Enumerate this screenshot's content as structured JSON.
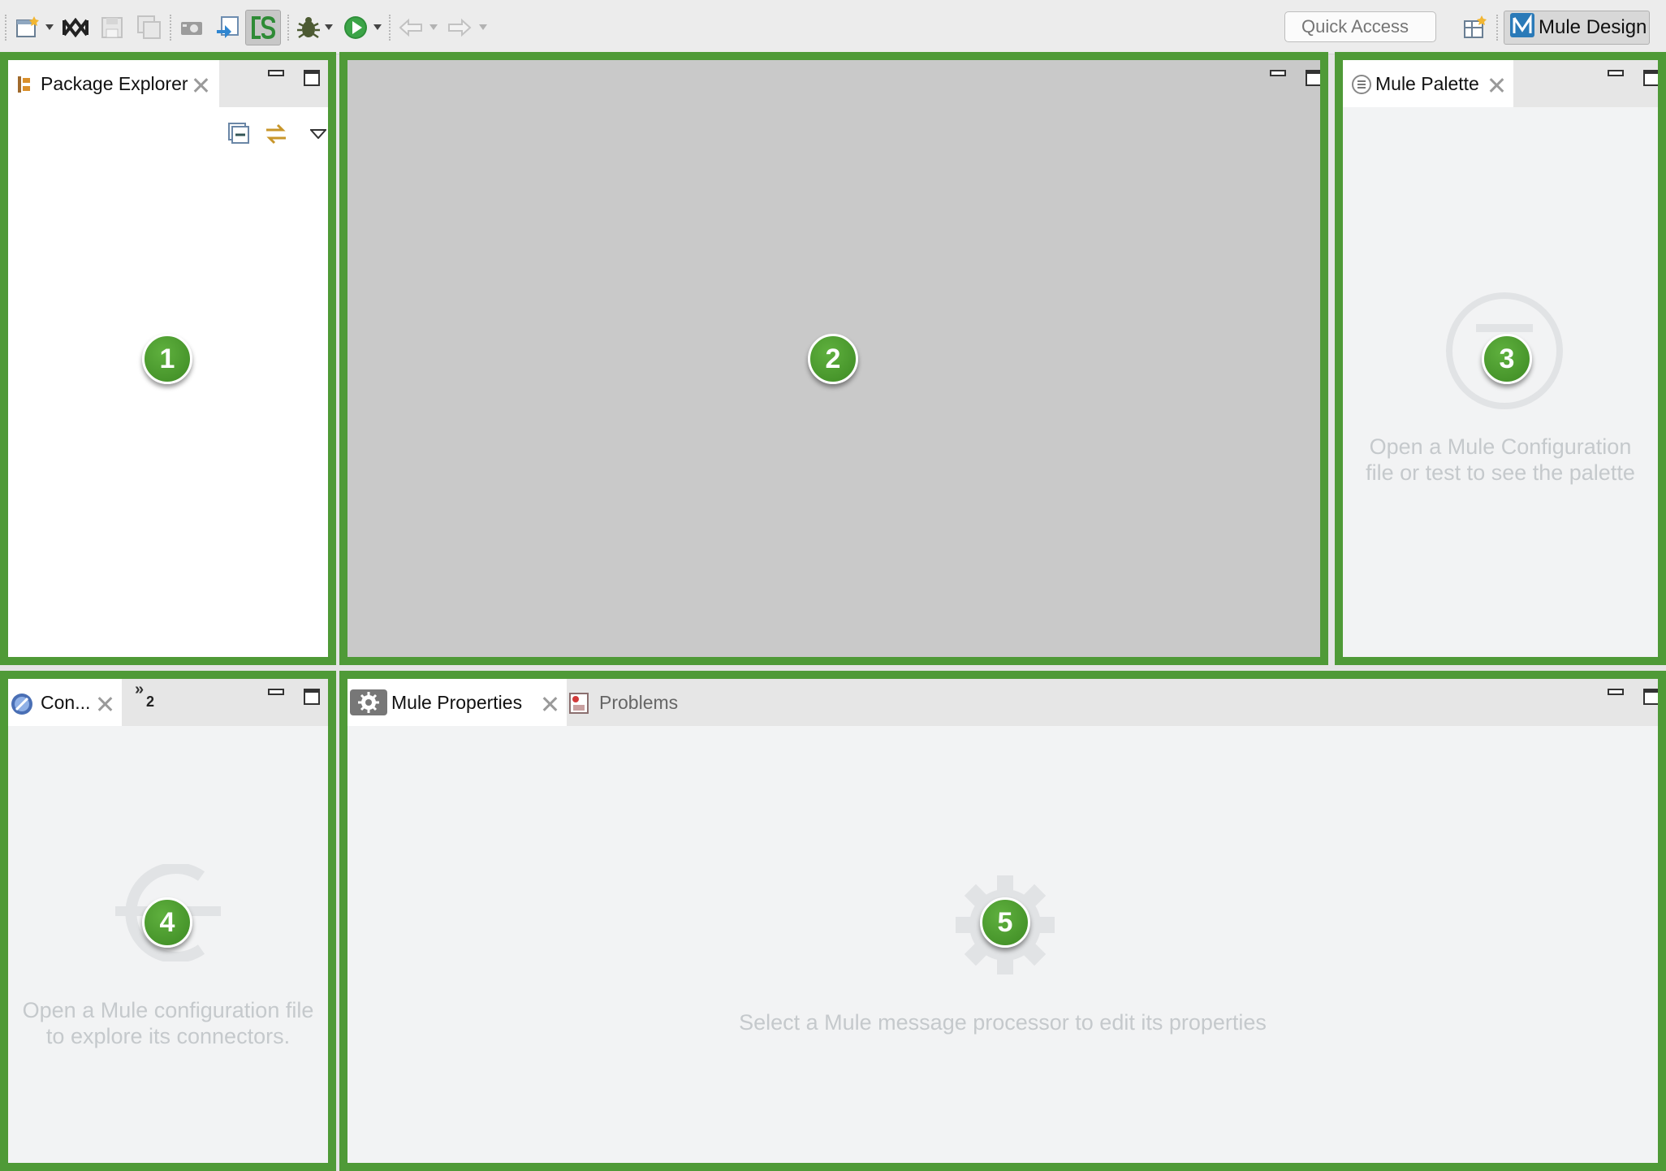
{
  "toolbar": {
    "buttons": [
      {
        "name": "new-wizard-icon"
      },
      {
        "name": "mule-logo-icon"
      },
      {
        "name": "save-icon"
      },
      {
        "name": "save-all-icon"
      },
      {
        "name": "camera-icon"
      },
      {
        "name": "deploy-icon"
      },
      {
        "name": "cs-icon"
      },
      {
        "name": "debug-icon"
      },
      {
        "name": "run-icon"
      },
      {
        "name": "back-arrow-icon"
      },
      {
        "name": "forward-arrow-icon"
      }
    ],
    "quick_access_placeholder": "Quick Access",
    "perspective_label": "Mule Design"
  },
  "panels": {
    "package_explorer": {
      "tab_label": "Package Explorer",
      "badge": "1"
    },
    "editor": {
      "badge": "2"
    },
    "palette": {
      "tab_label": "Mule Palette",
      "badge": "3",
      "hint_line1": "Open a Mule Configuration",
      "hint_line2": "file or test to see the palette"
    },
    "connectors": {
      "tab_label": "Con...",
      "overflow_count": "2",
      "badge": "4",
      "hint_line1": "Open a Mule configuration file",
      "hint_line2": "to explore its connectors."
    },
    "properties": {
      "tab_label": "Mule Properties",
      "problems_label": "Problems",
      "badge": "5",
      "hint": "Select a Mule message processor to edit its properties"
    }
  },
  "colors": {
    "frame_green": "#4f9a37",
    "badge_green": "#4a9a2e",
    "editor_gray": "#c9c9c9",
    "hint_gray": "#c5c9cc"
  }
}
